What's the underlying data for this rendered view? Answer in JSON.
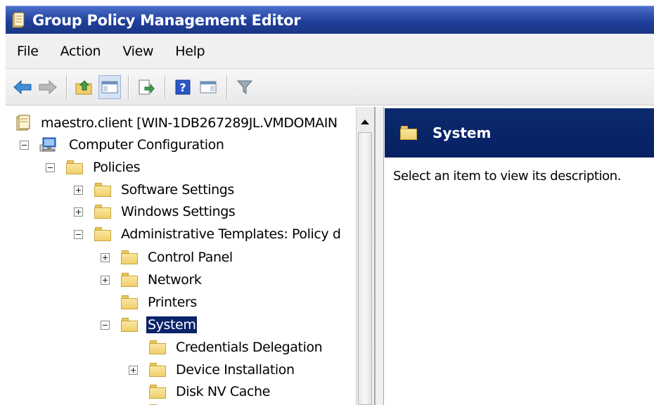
{
  "window": {
    "title": "Group Policy Management Editor"
  },
  "menu": [
    "File",
    "Action",
    "View",
    "Help"
  ],
  "toolbar": {
    "buttons": [
      "back-arrow-icon",
      "forward-arrow-icon",
      "up-folder-icon",
      "show-hide-console-tree-icon",
      "export-list-icon",
      "help-icon",
      "show-action-pane-icon",
      "filter-icon"
    ]
  },
  "tree": {
    "root": "maestro.client [WIN-1DB267289JL.VMDOMAIN",
    "computer_configuration": "Computer Configuration",
    "policies": "Policies",
    "software_settings": "Software Settings",
    "windows_settings": "Windows Settings",
    "administrative_templates": "Administrative Templates: Policy d",
    "control_panel": "Control Panel",
    "network": "Network",
    "printers": "Printers",
    "system": "System",
    "credentials_delegation": "Credentials Delegation",
    "device_installation": "Device Installation",
    "disk_nv_cache": "Disk NV Cache"
  },
  "details": {
    "header_title": "System",
    "description": "Select an item to view its description."
  },
  "colors": {
    "title_bar": "#1f3f9b",
    "selection": "#0a246a",
    "details_header": "#0b2a6d",
    "folder": "#f0cf6d"
  }
}
